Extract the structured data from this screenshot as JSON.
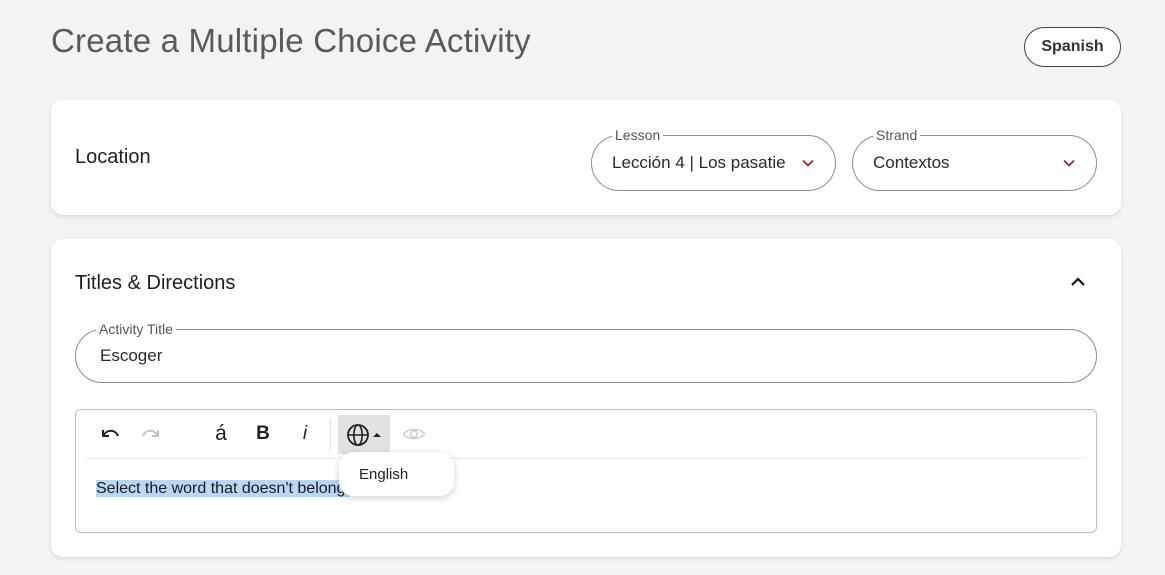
{
  "page": {
    "title": "Create a Multiple Choice Activity"
  },
  "header": {
    "language_button": "Spanish"
  },
  "location": {
    "heading": "Location",
    "lesson": {
      "label": "Lesson",
      "value": "Lección 4 | Los pasatie"
    },
    "strand": {
      "label": "Strand",
      "value": "Contextos"
    }
  },
  "titles": {
    "heading": "Titles & Directions",
    "activity_title": {
      "label": "Activity Title",
      "value": "Escoger"
    },
    "editor": {
      "toolbar": {
        "undo_icon": "undo-icon",
        "redo_icon": "redo-icon",
        "accent_label": "á",
        "bold_label": "B",
        "italic_label": "i",
        "language_icon": "globe-icon",
        "preview_icon": "eye-icon"
      },
      "language_menu": {
        "options": [
          "English"
        ]
      },
      "content": "Select the word that doesn't belong."
    }
  },
  "colors": {
    "accent": "#9b2b2b",
    "selection": "#b9d7f5",
    "toolbar_active": "#e2e2e2"
  }
}
